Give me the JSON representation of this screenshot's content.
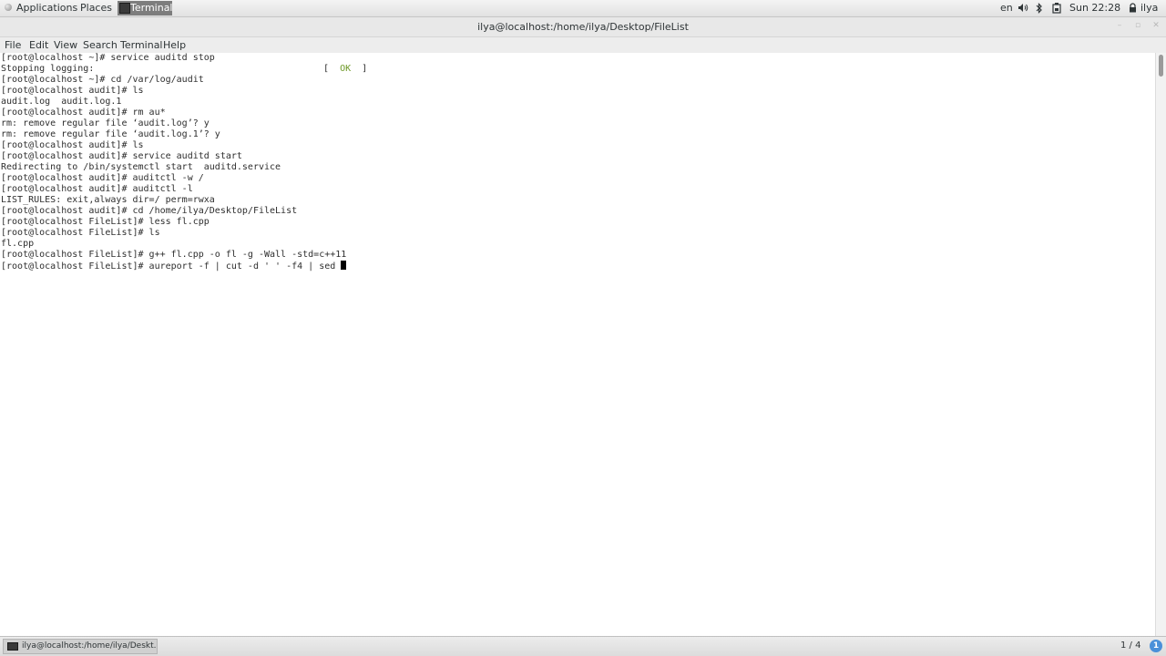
{
  "top_panel": {
    "applications": "Applications",
    "places": "Places",
    "task": "Terminal",
    "language": "en",
    "user": "ilya",
    "clock": "Sun 22:28"
  },
  "icons": {
    "volume": "volume-icon",
    "bluetooth": "bluetooth-icon",
    "battery": "battery-icon",
    "lock": "lock-icon"
  },
  "window": {
    "title": "ilya@localhost:/home/ilya/Desktop/FileList",
    "minimize": "–",
    "maximize": "▫",
    "close": "✕"
  },
  "menu": {
    "file": "File",
    "edit": "Edit",
    "view": "View",
    "search": "Search",
    "terminal": "Terminal",
    "help": "Help"
  },
  "terminal": {
    "lines": [
      "[root@localhost ~]# service auditd stop",
      "Stopping logging:",
      "[root@localhost ~]# cd /var/log/audit",
      "[root@localhost audit]# ls",
      "audit.log  audit.log.1",
      "[root@localhost audit]# rm au*",
      "rm: remove regular file ‘audit.log’? y",
      "rm: remove regular file ‘audit.log.1’? y",
      "[root@localhost audit]# ls",
      "[root@localhost audit]# service auditd start",
      "Redirecting to /bin/systemctl start  auditd.service",
      "[root@localhost audit]# auditctl -w /",
      "[root@localhost audit]# auditctl -l",
      "LIST_RULES: exit,always dir=/ perm=rwxa",
      "[root@localhost audit]# cd /home/ilya/Desktop/FileList",
      "[root@localhost FileList]# less fl.cpp",
      "[root@localhost FileList]# ls",
      "fl.cpp",
      "[root@localhost FileList]# g++ fl.cpp -o fl -g -Wall -std=c++11",
      "[root@localhost FileList]# aureport -f | cut -d ' ' -f4 | sed "
    ],
    "ok_status": "[  OK  ]"
  },
  "bottom_panel": {
    "task": "ilya@localhost:/home/ilya/Deskt...",
    "workspace": "1 / 4",
    "notification": "1"
  }
}
